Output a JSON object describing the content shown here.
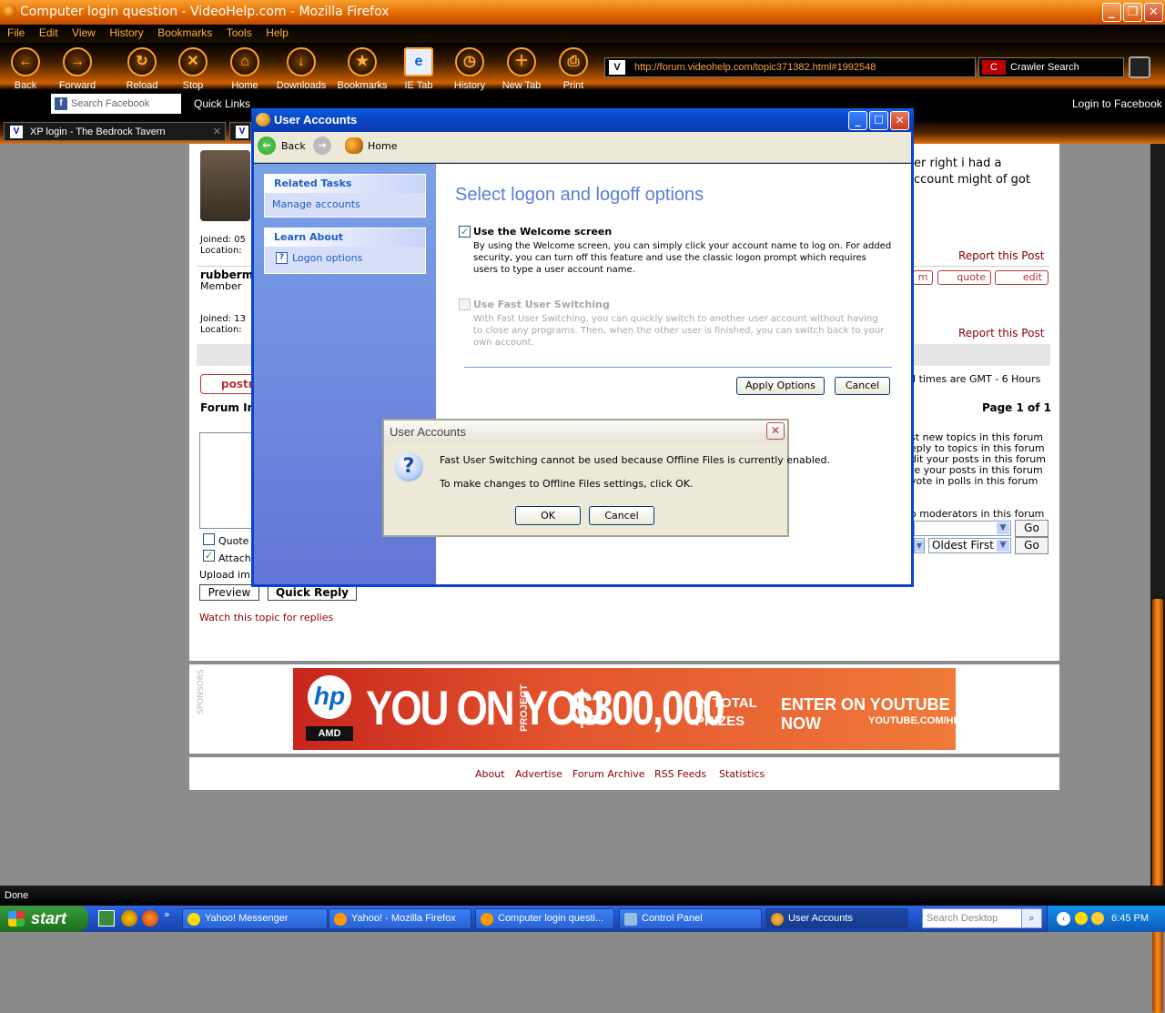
{
  "firefox": {
    "title": "Computer login question - VideoHelp.com - Mozilla Firefox",
    "menu": [
      "File",
      "Edit",
      "View",
      "History",
      "Bookmarks",
      "Tools",
      "Help"
    ],
    "toolbar": [
      {
        "label": "Back",
        "icon": "back-arrow"
      },
      {
        "label": "Forward",
        "icon": "forward-arrow"
      },
      {
        "label": "Reload",
        "icon": "reload"
      },
      {
        "label": "Stop",
        "icon": "stop-x"
      },
      {
        "label": "Home",
        "icon": "house"
      },
      {
        "label": "Downloads",
        "icon": "download"
      },
      {
        "label": "Bookmarks",
        "icon": "star"
      },
      {
        "label": "IE Tab",
        "icon": "ie-tab"
      },
      {
        "label": "History",
        "icon": "clock"
      },
      {
        "label": "New Tab",
        "icon": "new-tab"
      },
      {
        "label": "Print",
        "icon": "printer"
      }
    ],
    "url": "http://forum.videohelp.com/topic371382.html#1992548",
    "search_placeholder": "Crawler Search",
    "facebook_search_placeholder": "Search Facebook",
    "quick_links": "Quick Links",
    "login_facebook": "Login to Facebook",
    "tabs": [
      {
        "label": "XP login - The Bedrock Tavern"
      },
      {
        "label": ""
      }
    ],
    "status": "Done"
  },
  "forum": {
    "post_text_1": "er right i had a",
    "post_text_2": "ccount might of got",
    "joined_1": "Joined: 05",
    "location_1": "Location:",
    "report_1": "Report this Post",
    "user_2": "rubberm",
    "member_2": "Member",
    "joined_2": "Joined: 13",
    "location_2": "Location:",
    "report_2": "Report this Post",
    "btn_pm": "m",
    "btn_quote": "quote",
    "btn_edit": "edit",
    "post_reply": "postre",
    "timezone": "ll times are GMT - 6 Hours",
    "forum_index": "Forum In",
    "page_of": "Page 1 of 1",
    "permissions": [
      "st new topics in this forum",
      "eply to topics in this forum",
      "dit your posts in this forum",
      "te your posts in this forum",
      "vote in polls in this forum"
    ],
    "moderators": "o moderators in this forum",
    "go1": "Go",
    "go2": "Go",
    "order_select": "Oldest First",
    "quote_label": "Quote",
    "attach_label": "Attach",
    "upload_label": "Upload im",
    "preview_btn": "Preview",
    "quick_reply_btn": "Quick Reply",
    "watch_topic": "Watch this topic for replies",
    "sponsors": "SPONSORS",
    "ad": {
      "logo": "hp",
      "amd": "AMD",
      "slogan": "YOU ON YOU",
      "project": "PROJECT",
      "prize": "$300,000",
      "prize_note1": "IN TOTAL",
      "prize_note2": "PRIZES",
      "cta": "ENTER ON YOUTUBE NOW",
      "cta_url": "YOUTUBE.COM/HP"
    },
    "footer_links": [
      "About",
      "Advertise",
      "Forum Archive",
      "RSS Feeds",
      "Statistics"
    ]
  },
  "user_accounts": {
    "title": "User Accounts",
    "nav_back": "Back",
    "nav_home": "Home",
    "related_tasks": "Related Tasks",
    "manage_accounts": "Manage accounts",
    "learn_about": "Learn About",
    "logon_options": "Logon options",
    "heading": "Select logon and logoff options",
    "welcome_label": "Use the Welcome screen",
    "welcome_checked": true,
    "welcome_desc": "By using the Welcome screen, you can simply click your account name to log on. For added security, you can turn off this feature and use the classic logon prompt which requires users to type a user account name.",
    "fus_label": "Use Fast User Switching",
    "fus_checked": false,
    "fus_desc": "With Fast User Switching, you can quickly switch to another user account without having to close any programs. Then, when the other user is finished, you can switch back to your own account.",
    "apply_btn": "Apply Options",
    "cancel_btn": "Cancel"
  },
  "dialog": {
    "title": "User Accounts",
    "message1": "Fast User Switching cannot be used because Offline Files is currently enabled.",
    "message2": "To make changes to Offline Files settings, click OK.",
    "ok": "OK",
    "cancel": "Cancel"
  },
  "taskbar": {
    "start": "start",
    "tasks": [
      {
        "label": "Yahoo! Messenger"
      },
      {
        "label": "Yahoo! - Mozilla Firefox"
      },
      {
        "label": "Computer login questi..."
      },
      {
        "label": "Control Panel"
      },
      {
        "label": "User Accounts"
      }
    ],
    "desktop_search": "Search Desktop",
    "clock": "6:45 PM"
  }
}
